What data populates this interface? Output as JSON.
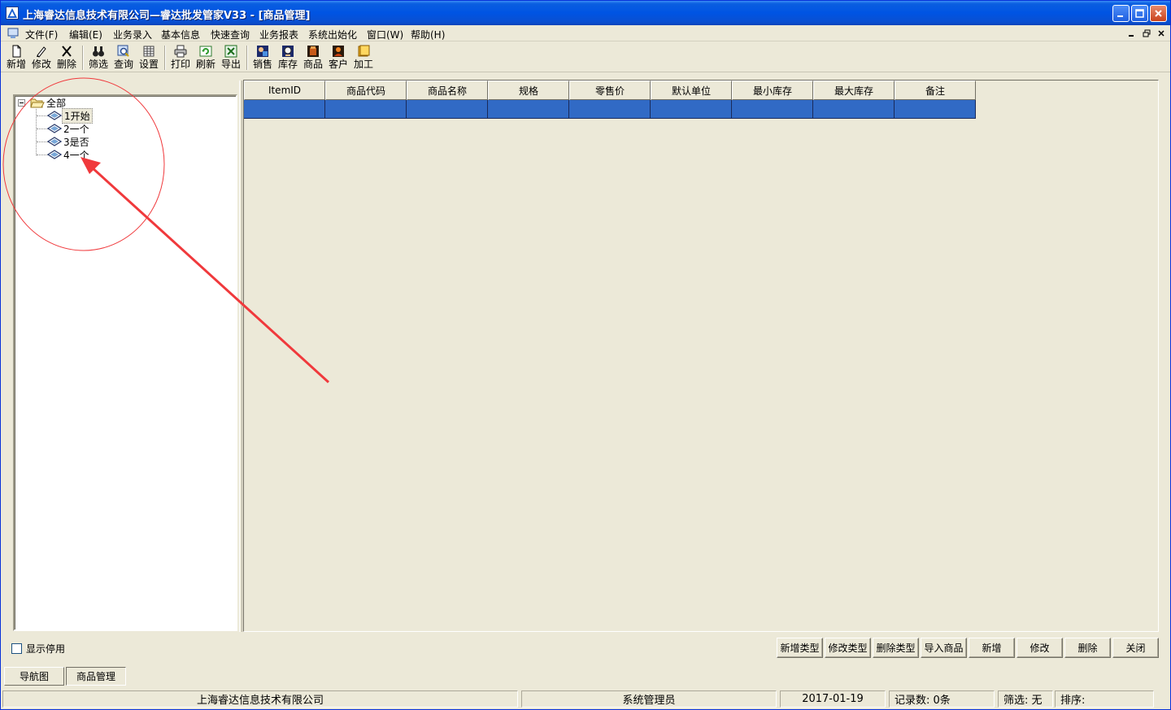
{
  "window": {
    "title": "上海睿达信息技术有限公司—睿达批发管家V33 - [商品管理]"
  },
  "menu": {
    "items": [
      "文件(F)",
      "编辑(E)",
      "业务录入",
      "基本信息",
      "快速查询",
      "业务报表",
      "系统出始化",
      "窗口(W)",
      "帮助(H)"
    ]
  },
  "toolbar": {
    "buttons": [
      {
        "label": "新增",
        "icon": "new-file-icon"
      },
      {
        "label": "修改",
        "icon": "edit-icon"
      },
      {
        "label": "删除",
        "icon": "delete-icon"
      },
      {
        "label": "筛选",
        "icon": "binoculars-icon"
      },
      {
        "label": "查询",
        "icon": "search-icon"
      },
      {
        "label": "设置",
        "icon": "settings-icon"
      },
      {
        "label": "打印",
        "icon": "printer-icon"
      },
      {
        "label": "刷新",
        "icon": "refresh-icon"
      },
      {
        "label": "导出",
        "icon": "excel-export-icon"
      },
      {
        "label": "销售",
        "icon": "sales-icon"
      },
      {
        "label": "库存",
        "icon": "inventory-icon"
      },
      {
        "label": "商品",
        "icon": "product-icon"
      },
      {
        "label": "客户",
        "icon": "customer-icon"
      },
      {
        "label": "加工",
        "icon": "process-icon"
      }
    ]
  },
  "tree": {
    "root": "全部",
    "children": [
      "1开始",
      "2一个",
      "3是否",
      "4一个"
    ],
    "selected_index": 0
  },
  "grid": {
    "columns": [
      "ItemID",
      "商品代码",
      "商品名称",
      "规格",
      "零售价",
      "默认单位",
      "最小库存",
      "最大库存",
      "备注"
    ],
    "rows": [
      [
        "",
        "",
        "",
        "",
        "",
        "",
        "",
        "",
        ""
      ]
    ]
  },
  "bottom": {
    "show_disabled_label": "显示停用",
    "show_disabled_checked": false,
    "buttons": [
      "新增类型",
      "修改类型",
      "删除类型",
      "导入商品",
      "新增",
      "修改",
      "删除",
      "关闭"
    ]
  },
  "tabs": [
    "导航图",
    "商品管理"
  ],
  "statusbar": {
    "company": "上海睿达信息技术有限公司",
    "user": "系统管理员",
    "date": "2017-01-19",
    "records": "记录数: 0条",
    "filter": "筛选: 无",
    "sort": "排序:"
  },
  "colors": {
    "titlebar": "#0054e3",
    "selected_row": "#316ac5",
    "annotation": "#f0393c"
  }
}
